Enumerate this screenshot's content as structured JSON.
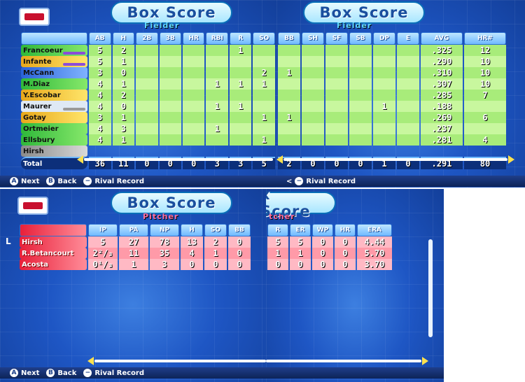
{
  "fielder": {
    "title": "Box Score",
    "subtitle": "Fielder",
    "columns_left": [
      "AB",
      "H",
      "2B",
      "3B",
      "HR",
      "RBI",
      "R",
      "SO"
    ],
    "columns_right": [
      "BB",
      "SH",
      "SF",
      "SB",
      "DP",
      "E",
      "AVG",
      "HR#"
    ],
    "rows": [
      {
        "name": "Francoeur",
        "color": "c-green",
        "bar": "#8b4dd8",
        "left": [
          "5",
          "2",
          "",
          "",
          "",
          "",
          "1",
          ""
        ],
        "right": [
          "",
          "",
          "",
          "",
          "",
          "",
          ".325",
          "12"
        ]
      },
      {
        "name": "Infante",
        "color": "c-yellow",
        "bar": "#8b4dd8",
        "left": [
          "5",
          "1",
          "",
          "",
          "",
          "",
          "",
          ""
        ],
        "right": [
          "",
          "",
          "",
          "",
          "",
          "",
          ".290",
          "10"
        ]
      },
      {
        "name": "McCann",
        "color": "c-blue",
        "bar": "",
        "left": [
          "3",
          "0",
          "",
          "",
          "",
          "",
          "",
          "2"
        ],
        "right": [
          "1",
          "",
          "",
          "",
          "",
          "",
          ".310",
          "10"
        ]
      },
      {
        "name": "M.Diaz",
        "color": "c-green",
        "bar": "",
        "left": [
          "4",
          "1",
          "",
          "",
          "",
          "1",
          "1",
          "1"
        ],
        "right": [
          "",
          "",
          "",
          "",
          "",
          "",
          ".307",
          "10"
        ]
      },
      {
        "name": "Y.Escobar",
        "color": "c-yellow",
        "bar": "",
        "left": [
          "4",
          "2",
          "",
          "",
          "",
          "",
          "",
          ""
        ],
        "right": [
          "",
          "",
          "",
          "",
          "",
          "",
          ".285",
          "7"
        ]
      },
      {
        "name": "Maurer",
        "color": "c-white",
        "bar": "#9a9a9a",
        "left": [
          "4",
          "0",
          "",
          "",
          "",
          "1",
          "1",
          ""
        ],
        "right": [
          "",
          "",
          "",
          "",
          "1",
          "",
          ".188",
          ""
        ]
      },
      {
        "name": "Gotay",
        "color": "c-yellow",
        "bar": "",
        "left": [
          "3",
          "1",
          "",
          "",
          "",
          "",
          "",
          "1"
        ],
        "right": [
          "1",
          "",
          "",
          "",
          "",
          "",
          ".269",
          "6"
        ]
      },
      {
        "name": "Ortmeier",
        "color": "c-green",
        "bar": "",
        "left": [
          "4",
          "3",
          "",
          "",
          "",
          "1",
          "",
          ""
        ],
        "right": [
          "",
          "",
          "",
          "",
          "",
          "",
          ".237",
          ""
        ]
      },
      {
        "name": "Ellsbury",
        "color": "c-green",
        "bar": "",
        "left": [
          "4",
          "1",
          "",
          "",
          "",
          "",
          "",
          "1"
        ],
        "right": [
          "",
          "",
          "",
          "",
          "",
          "",
          ".281",
          "4"
        ]
      }
    ],
    "partial_row_name": "Hirsh",
    "total_label": "Total",
    "totals_left": [
      "36",
      "11",
      "0",
      "0",
      "0",
      "3",
      "3",
      "5"
    ],
    "totals_right": [
      "2",
      "0",
      "0",
      "0",
      "1",
      "0",
      ".291",
      "80"
    ]
  },
  "pitcher": {
    "title": "Box Score",
    "title_right_partial": "x Score",
    "subtitle": "Pitcher",
    "subtitle_right_partial": "tcher",
    "columns_left": [
      "IP",
      "PA",
      "NP",
      "H",
      "SO",
      "BB"
    ],
    "columns_right": [
      "R",
      "ER",
      "WP",
      "HR",
      "ERA"
    ],
    "cursor_label": "L",
    "rows": [
      {
        "name": "Hirsh",
        "left": [
          "5",
          "27",
          "78",
          "13",
          "2",
          "0"
        ],
        "right": [
          "5",
          "5",
          "0",
          "0",
          "4.44"
        ]
      },
      {
        "name": "R.Betancourt",
        "left": [
          "2²/₃",
          "11",
          "35",
          "4",
          "1",
          "0"
        ],
        "right": [
          "1",
          "1",
          "0",
          "0",
          "5.70"
        ]
      },
      {
        "name": "Acosta",
        "left": [
          "0¹/₃",
          "1",
          "3",
          "0",
          "0",
          "0"
        ],
        "right": [
          "0",
          "0",
          "0",
          "0",
          "3.70"
        ]
      }
    ]
  },
  "footer": {
    "next_key": "A",
    "next_label": "Next",
    "back_key": "B",
    "back_label": "Back",
    "rival_key": "−",
    "rival_label": "Rival Record",
    "partial_prefix": "<"
  },
  "colors": {
    "accent": "#1e56c4",
    "pitcher_row": "#ff9aa8",
    "fielder_row": "#a8ec7a",
    "title_text": "#1a4f9e"
  },
  "icons": [
    "team-logo-icon",
    "left-arrow-icon",
    "right-arrow-icon"
  ]
}
